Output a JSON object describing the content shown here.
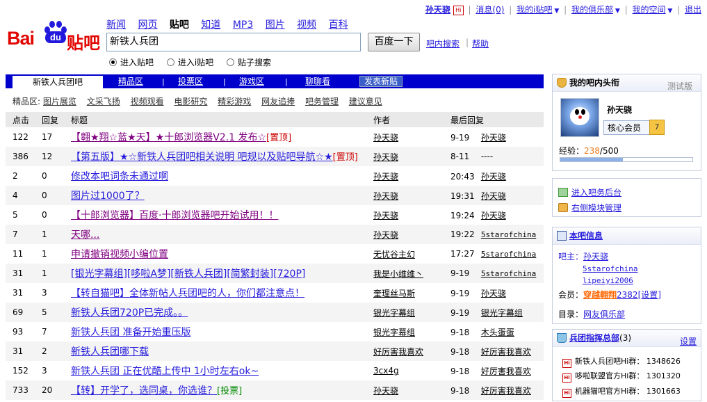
{
  "userbar": {
    "username": "孙天骁",
    "messages_label": "消息",
    "messages_count": "(0)",
    "my_ibar": "我的i贴吧",
    "my_club": "我的俱乐部",
    "my_space": "我的空间",
    "logout": "退出"
  },
  "logo": {
    "bai": "Bai",
    "du": "du",
    "tieba": "贴吧"
  },
  "nav": {
    "items": [
      "新闻",
      "网页",
      "贴吧",
      "知道",
      "MP3",
      "图片",
      "视频",
      "百科"
    ],
    "current": "贴吧"
  },
  "search": {
    "value": "新铁人兵团",
    "button": "百度一下",
    "inbar": "吧内搜索",
    "help": "帮助",
    "radios": [
      "进入贴吧",
      "进入i贴吧",
      "贴子搜索"
    ],
    "selected": "进入贴吧"
  },
  "tabs": {
    "active": "新铁人兵团吧",
    "items": [
      "精品区",
      "投票区",
      "游戏区",
      "聊聊看"
    ],
    "post_button": "发表新贴"
  },
  "subnav": {
    "label": "精品区:",
    "items": [
      "图片展览",
      "文采飞扬",
      "视频观看",
      "电影研究",
      "精彩游戏",
      "网友追捧",
      "吧务管理",
      "建议意见"
    ]
  },
  "table": {
    "headers": [
      "点击",
      "回复",
      "标题",
      "作者",
      "最后回复"
    ],
    "rows": [
      {
        "clicks": "122",
        "replies": "17",
        "title": "【翱★翔☆蓝★天】★十郎浏览器V2.1 发布☆",
        "tag": "置顶",
        "tagtype": "red",
        "visited": true,
        "author": "孙天骁",
        "time": "9-19",
        "last": "孙天骁"
      },
      {
        "clicks": "386",
        "replies": "12",
        "title": "【第五版】★☆新铁人兵团吧相关说明 吧规以及贴吧导航☆★",
        "tag": "置顶",
        "tagtype": "red",
        "visited": false,
        "author": "孙天骁",
        "time": "8-11",
        "last": "----"
      },
      {
        "clicks": "2",
        "replies": "0",
        "title": "修改本吧词条未通过啊",
        "tag": "",
        "tagtype": "",
        "visited": false,
        "author": "孙天骁",
        "time": "20:43",
        "last": "孙天骁"
      },
      {
        "clicks": "4",
        "replies": "0",
        "title": "图片过1000了？",
        "tag": "",
        "tagtype": "",
        "visited": false,
        "author": "孙天骁",
        "time": "19:31",
        "last": "孙天骁"
      },
      {
        "clicks": "5",
        "replies": "0",
        "title": "【十郎浏览器】百度·十郎浏览器吧开始试用！！",
        "tag": "",
        "tagtype": "",
        "visited": true,
        "author": "孙天骁",
        "time": "19:24",
        "last": "孙天骁"
      },
      {
        "clicks": "7",
        "replies": "1",
        "title": "天哪...",
        "tag": "",
        "tagtype": "",
        "visited": true,
        "author": "孙天骁",
        "time": "19:22",
        "last": "5starofchina"
      },
      {
        "clicks": "11",
        "replies": "1",
        "title": "申请撤销视频小编位置",
        "tag": "",
        "tagtype": "",
        "visited": true,
        "author": "无忧谷主幻",
        "time": "17:27",
        "last": "5starofchina"
      },
      {
        "clicks": "31",
        "replies": "1",
        "title": "[银光字幕组][哆啦A梦][新铁人兵团][简繁封装][720P]",
        "tag": "",
        "tagtype": "",
        "visited": false,
        "author": "我是小维维丶",
        "time": "9-19",
        "last": "5starofchina"
      },
      {
        "clicks": "31",
        "replies": "3",
        "title": "【转自猫吧】全体新帖人兵团吧的人，你们都注意点！",
        "tag": "",
        "tagtype": "",
        "visited": false,
        "author": "奎理丝马斯",
        "time": "9-19",
        "last": "孙天骁"
      },
      {
        "clicks": "69",
        "replies": "5",
        "title": "新铁人兵团720P已完成。。",
        "tag": "",
        "tagtype": "",
        "visited": false,
        "author": "银光字幕组",
        "time": "9-19",
        "last": "银光字幕组"
      },
      {
        "clicks": "93",
        "replies": "7",
        "title": "新铁人兵团 准备开始重压版",
        "tag": "",
        "tagtype": "",
        "visited": false,
        "author": "银光字幕组",
        "time": "9-18",
        "last": "木头蛋蛋"
      },
      {
        "clicks": "31",
        "replies": "2",
        "title": "新铁人兵团哪下载",
        "tag": "",
        "tagtype": "",
        "visited": false,
        "author": "好厉害我喜欢",
        "time": "9-18",
        "last": "好厉害我喜欢"
      },
      {
        "clicks": "152",
        "replies": "3",
        "title": "新铁人兵团 正在优酷上传中 1小时左右ok~",
        "tag": "",
        "tagtype": "",
        "visited": false,
        "author": "3cx4g",
        "time": "9-18",
        "last": "好厉害我喜欢"
      },
      {
        "clicks": "733",
        "replies": "20",
        "title": "【转】开学了，选同桌，你选谁？",
        "tag": "投票",
        "tagtype": "green",
        "visited": false,
        "author": "孙天骁",
        "time": "9-18",
        "last": "好厉害我喜欢"
      }
    ]
  },
  "sidebar": {
    "headlines": {
      "title": "我的吧内头衔",
      "beta": "测试版",
      "name": "孙天骁",
      "role": "核心会员",
      "level": "7",
      "exp_label": "经验：",
      "exp_current": "238",
      "exp_total": "/500",
      "exp_fraction": 0.476
    },
    "admin": {
      "enter": "进入吧务后台",
      "manage": "右侧模块管理"
    },
    "info": {
      "title": "本吧信息",
      "owner_label": "吧主：",
      "owners": [
        "孙天骁",
        "5starofchina",
        "lipeiyi2006"
      ],
      "member_label": "会员：",
      "member_name": "穿越翱翔",
      "member_count": "2382",
      "member_setting": "[设置]",
      "dir_label": "目录：",
      "dir": "网友俱乐部"
    },
    "groups": {
      "title": "兵团指挥总部",
      "count": "(3)",
      "setting": "设置",
      "items": [
        {
          "name": "新铁人兵团吧Hi群：",
          "id": "1348626"
        },
        {
          "name": "哆啦联盟官方Hi群：",
          "id": "1301320"
        },
        {
          "name": "机器猫吧官方Hi群：",
          "id": "1301663"
        }
      ]
    }
  }
}
